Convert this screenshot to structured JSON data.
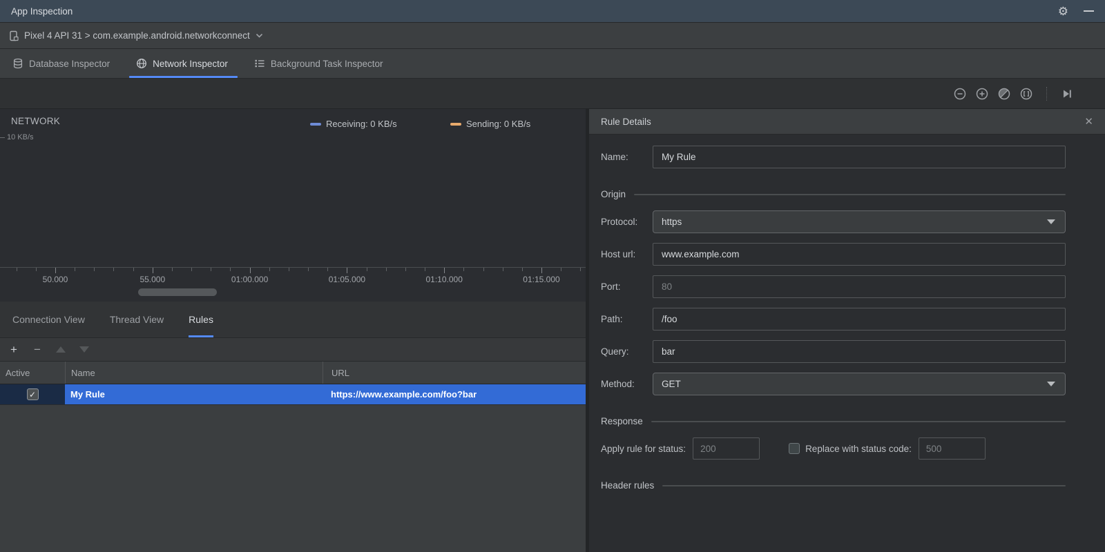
{
  "window": {
    "title": "App Inspection"
  },
  "icons": {
    "gear": "⚙",
    "check": "✓",
    "close": "✕",
    "add": "+",
    "remove": "−"
  },
  "device_bar": {
    "selection": "Pixel 4 API 31 > com.example.android.networkconnect"
  },
  "inspector_tabs": [
    {
      "label": "Database Inspector",
      "active": false
    },
    {
      "label": "Network Inspector",
      "active": true
    },
    {
      "label": "Background Task Inspector",
      "active": false
    }
  ],
  "zoom_toolbar": {
    "icons": [
      "zoom-out",
      "zoom-in",
      "reset-zoom",
      "zoom-to-selection",
      "jump-to-live"
    ]
  },
  "chart_data": {
    "type": "line",
    "title": "NETWORK",
    "y_tick_label": "10 KB/s",
    "ylim": [
      0,
      10
    ],
    "ylabel": "KB/s",
    "x_ticks": [
      "50.000",
      "55.000",
      "01:00.000",
      "01:05.000",
      "01:10.000",
      "01:15.000"
    ],
    "series": [
      {
        "name": "Receiving",
        "legend_label": "Receiving: 0 KB/s",
        "current_value": 0,
        "color": "#6E8BD6",
        "values": [
          0,
          0,
          0,
          0,
          0,
          0
        ]
      },
      {
        "name": "Sending",
        "legend_label": "Sending: 0 KB/s",
        "current_value": 0,
        "color": "#E8AA6C",
        "values": [
          0,
          0,
          0,
          0,
          0,
          0
        ]
      }
    ],
    "legend_position": "top",
    "grid": false
  },
  "view_tabs": [
    {
      "label": "Connection View",
      "active": false
    },
    {
      "label": "Thread View",
      "active": false
    },
    {
      "label": "Rules",
      "active": true
    }
  ],
  "rules_table": {
    "columns": [
      "Active",
      "Name",
      "URL"
    ],
    "rows": [
      {
        "active": true,
        "name": "My Rule",
        "url": "https://www.example.com/foo?bar",
        "selected": true
      }
    ]
  },
  "rule_details": {
    "title": "Rule Details",
    "name_label": "Name:",
    "name_value": "My Rule",
    "sections": {
      "origin": "Origin",
      "response": "Response",
      "header_rules": "Header rules"
    },
    "origin": {
      "protocol_label": "Protocol:",
      "protocol_value": "https",
      "host_label": "Host url:",
      "host_value": "www.example.com",
      "port_label": "Port:",
      "port_placeholder": "80",
      "path_label": "Path:",
      "path_value": "/foo",
      "query_label": "Query:",
      "query_value": "bar",
      "method_label": "Method:",
      "method_value": "GET"
    },
    "response": {
      "status_label": "Apply rule for status:",
      "status_placeholder": "200",
      "replace_label": "Replace with status code:",
      "replace_placeholder": "500",
      "replace_checked": false
    }
  },
  "colors": {
    "titlebar": "#3C4956",
    "accent_underline": "#548AF7",
    "selection_blue": "#336BD6",
    "receiving": "#6E8BD6",
    "sending": "#E8AA6C"
  }
}
